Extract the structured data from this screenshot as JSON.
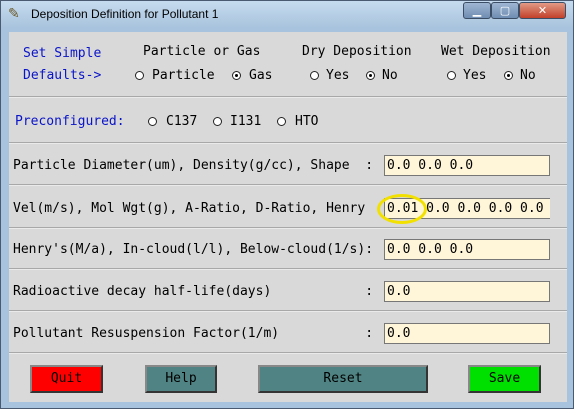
{
  "window": {
    "title": "Deposition Definition for Pollutant 1",
    "min_symbol": "▁",
    "max_symbol": "▢",
    "close_symbol": "✕"
  },
  "defaults": {
    "line1": "Set Simple",
    "line2": "Defaults->"
  },
  "groups": {
    "particle_gas": {
      "label": "Particle or Gas",
      "options": [
        "Particle",
        "Gas"
      ],
      "selected": "Gas"
    },
    "dry": {
      "label": "Dry Deposition",
      "options": [
        "Yes",
        "No"
      ],
      "selected": "No"
    },
    "wet": {
      "label": "Wet Deposition",
      "options": [
        "Yes",
        "No"
      ],
      "selected": "No"
    }
  },
  "preconfigured": {
    "label": "Preconfigured:",
    "options": [
      "C137",
      "I131",
      "HTO"
    ]
  },
  "fields": [
    {
      "label": "Particle Diameter(um), Density(g/cc), Shape  :",
      "value": "0.0 0.0 0.0"
    },
    {
      "label": "Vel(m/s), Mol Wgt(g), A-Ratio, D-Ratio, Henry",
      "value": "0.01 0.0 0.0 0.0 0.0"
    },
    {
      "label": "Henry's(M/a), In-cloud(l/l), Below-cloud(1/s):",
      "value": "0.0 0.0 0.0"
    },
    {
      "label": "Radioactive decay half-life(days)            :",
      "value": "0.0"
    },
    {
      "label": "Pollutant Resuspension Factor(1/m)           :",
      "value": "0.0"
    }
  ],
  "buttons": {
    "quit": "Quit",
    "help": "Help",
    "reset": "Reset",
    "save": "Save"
  },
  "colors": {
    "quit": "#ff0000",
    "help": "#508484",
    "reset": "#508484",
    "save": "#00e000",
    "entry_bg": "#fff6d9",
    "highlight": "#f2e100"
  }
}
